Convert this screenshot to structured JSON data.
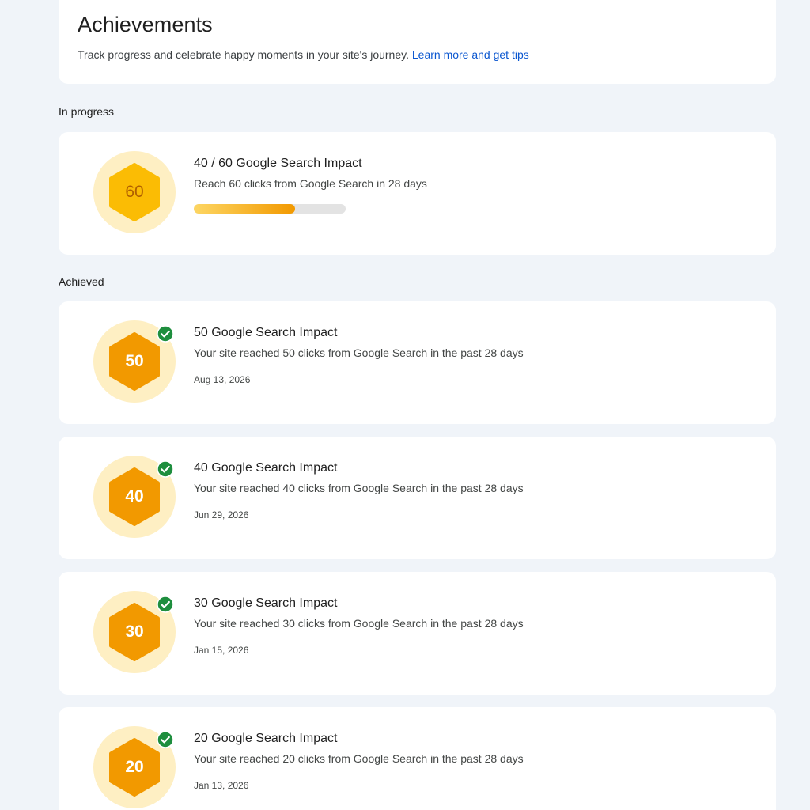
{
  "header": {
    "title": "Achievements",
    "description": "Track progress and celebrate happy moments in your site's journey.",
    "link_label": "Learn more and get tips"
  },
  "sections": {
    "in_progress_label": "In progress",
    "achieved_label": "Achieved"
  },
  "in_progress": {
    "badge_number": "60",
    "title": "40 / 60 Google Search Impact",
    "description": "Reach 60 clicks from Google Search in 28 days",
    "progress_fraction": 0.667
  },
  "achieved": [
    {
      "badge_number": "50",
      "title": "50 Google Search Impact",
      "description": "Your site reached 50 clicks from Google Search in the past 28 days",
      "date": "Aug 13, 2026"
    },
    {
      "badge_number": "40",
      "title": "40 Google Search Impact",
      "description": "Your site reached 40 clicks from Google Search in the past 28 days",
      "date": "Jun 29, 2026"
    },
    {
      "badge_number": "30",
      "title": "30 Google Search Impact",
      "description": "Your site reached 30 clicks from Google Search in the past 28 days",
      "date": "Jan 15, 2026"
    },
    {
      "badge_number": "20",
      "title": "20 Google Search Impact",
      "description": "Your site reached 20 clicks from Google Search in the past 28 days",
      "date": "Jan 13, 2026"
    }
  ],
  "icons": {
    "badge": "hexagon-badge-icon",
    "achieved_check": "check-circle-icon"
  },
  "colors": {
    "page_background": "#f0f4f9",
    "badge_circle": "#feefc3",
    "badge_hex_achieved": "#f29900",
    "badge_hex_in_progress": "#fbbc04",
    "check_green": "#1e8e3e",
    "link_blue": "#0b57d0"
  }
}
